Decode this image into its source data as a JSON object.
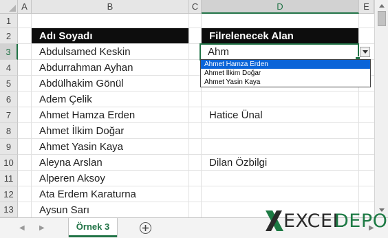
{
  "columns": [
    {
      "letter": "A"
    },
    {
      "letter": "B"
    },
    {
      "letter": "C"
    },
    {
      "letter": "D"
    },
    {
      "letter": "E"
    }
  ],
  "rows": [
    "1",
    "2",
    "3",
    "4",
    "5",
    "6",
    "7",
    "8",
    "9",
    "10",
    "11",
    "12",
    "13"
  ],
  "headers": {
    "b2": "Adı Soyadı",
    "d2": "Filrelenecek Alan"
  },
  "names": [
    "Abdulsamed Keskin",
    "Abdurrahman Ayhan",
    "Abdülhakim Gönül",
    "Adem Çelik",
    "Ahmet Hamza Erden",
    "Ahmet İlkim Doğar",
    "Ahmet Yasin Kaya",
    "Aleyna Arslan",
    "Alperen Aksoy",
    "Ata Erdem Karaturna",
    "Aysun Sarı"
  ],
  "active_cell_value": "Ahm",
  "dropdown": {
    "items": [
      "Ahmet Hamza Erden",
      "Ahmet İlkim Doğar",
      "Ahmet Yasin Kaya"
    ],
    "highlighted_index": 0
  },
  "d_column_values": {
    "d7": "Hatice Ünal",
    "d10": "Dilan Özbilgi"
  },
  "sheet_tab": "Örnek 3",
  "logo": {
    "text_left": "EXCEL",
    "text_right": "DEPO"
  },
  "colors": {
    "excel_green": "#217346",
    "header_fill": "#0d0d0d",
    "dropdown_highlight": "#0a64d8",
    "logo_green": "#1d7a44"
  }
}
